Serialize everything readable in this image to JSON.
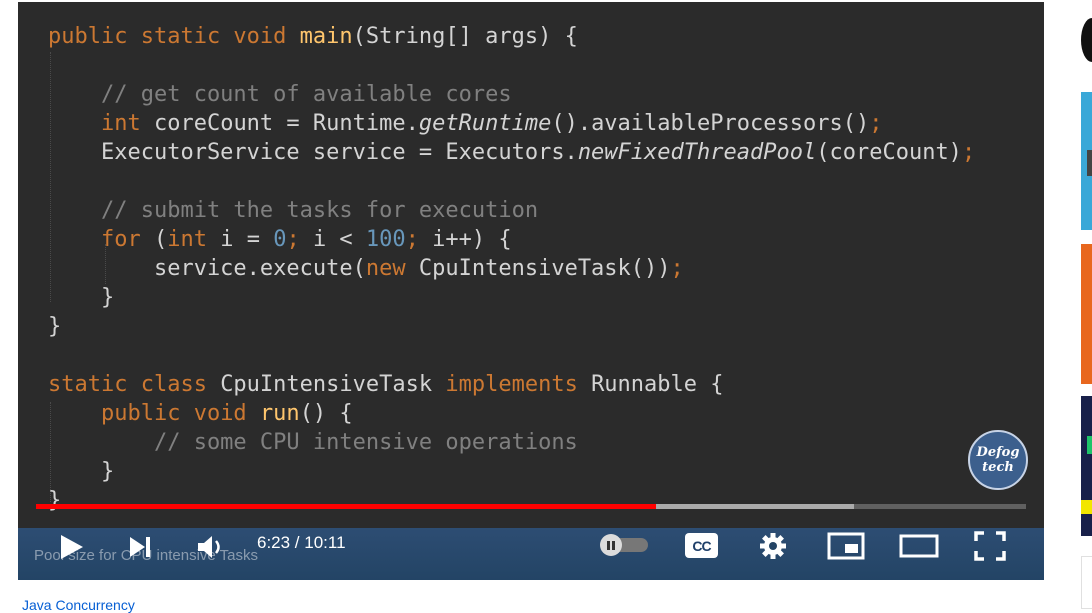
{
  "player": {
    "code_lines": [
      [
        {
          "t": "public static void ",
          "c": "kw"
        },
        {
          "t": "main",
          "c": "fn"
        },
        {
          "t": "(String[] args) {",
          "c": "pl"
        }
      ],
      [],
      [
        {
          "t": "    // get count of available cores",
          "c": "cm"
        }
      ],
      [
        {
          "t": "    ",
          "c": "pl"
        },
        {
          "t": "int ",
          "c": "kw"
        },
        {
          "t": "coreCount = Runtime.",
          "c": "pl"
        },
        {
          "t": "getRuntime",
          "c": "it"
        },
        {
          "t": "().availableProcessors()",
          "c": "pl"
        },
        {
          "t": ";",
          "c": "kw"
        }
      ],
      [
        {
          "t": "    ExecutorService service = Executors.",
          "c": "pl"
        },
        {
          "t": "newFixedThreadPool",
          "c": "it"
        },
        {
          "t": "(coreCount)",
          "c": "pl"
        },
        {
          "t": ";",
          "c": "kw"
        }
      ],
      [],
      [
        {
          "t": "    // submit the tasks for execution",
          "c": "cm"
        }
      ],
      [
        {
          "t": "    ",
          "c": "pl"
        },
        {
          "t": "for ",
          "c": "kw"
        },
        {
          "t": "(",
          "c": "pl"
        },
        {
          "t": "int ",
          "c": "kw"
        },
        {
          "t": "i = ",
          "c": "pl"
        },
        {
          "t": "0",
          "c": "num"
        },
        {
          "t": "; ",
          "c": "kw"
        },
        {
          "t": "i < ",
          "c": "pl"
        },
        {
          "t": "100",
          "c": "num"
        },
        {
          "t": "; ",
          "c": "kw"
        },
        {
          "t": "i++) {",
          "c": "pl"
        }
      ],
      [
        {
          "t": "        service.execute(",
          "c": "pl"
        },
        {
          "t": "new ",
          "c": "kw"
        },
        {
          "t": "CpuIntensiveTask())",
          "c": "pl"
        },
        {
          "t": ";",
          "c": "kw"
        }
      ],
      [
        {
          "t": "    }",
          "c": "pl"
        }
      ],
      [
        {
          "t": "}",
          "c": "pl"
        }
      ],
      [],
      [
        {
          "t": "static class ",
          "c": "kw"
        },
        {
          "t": "CpuIntensiveTask ",
          "c": "pl"
        },
        {
          "t": "implements ",
          "c": "kw"
        },
        {
          "t": "Runnable {",
          "c": "pl"
        }
      ],
      [
        {
          "t": "    ",
          "c": "pl"
        },
        {
          "t": "public void ",
          "c": "kw"
        },
        {
          "t": "run",
          "c": "fn"
        },
        {
          "t": "() {",
          "c": "pl"
        }
      ],
      [
        {
          "t": "        // some CPU intensive operations",
          "c": "cm"
        }
      ],
      [
        {
          "t": "    }",
          "c": "pl"
        }
      ],
      [
        {
          "t": "}",
          "c": "pl"
        }
      ]
    ],
    "logo_line1": "Defog",
    "logo_line2": "tech",
    "progress": {
      "played_fraction": 0.626,
      "buffered_fraction": 0.826
    },
    "time_display": "6:23 / 10:11",
    "chapter_title": "Pool size for CPU intensive Tasks",
    "cc_label": "CC",
    "icons": [
      "play-icon",
      "next-icon",
      "volume-icon",
      "autoplay-toggle",
      "cc-icon",
      "gear-icon",
      "miniplayer-icon",
      "theater-icon",
      "fullscreen-icon"
    ]
  },
  "below": {
    "playlist_link": "Java Concurrency"
  },
  "colors": {
    "progress_played": "#ff0000",
    "code_background": "#2b2b2b",
    "keyword": "#cc7832",
    "function": "#ffc66d",
    "number": "#6897bb",
    "comment": "#808080"
  }
}
